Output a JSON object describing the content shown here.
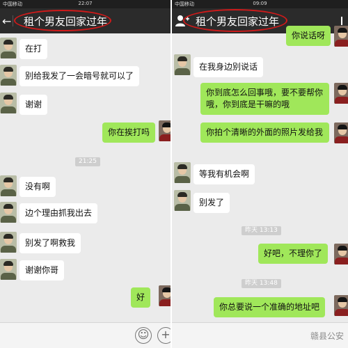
{
  "left": {
    "status": {
      "carrier": "中国移动",
      "time": "22:07"
    },
    "title": "租个男友回家过年",
    "messages": [
      {
        "id": "l1",
        "text": "在打"
      },
      {
        "id": "l2",
        "text": "别给我发了一会暗号就可以了"
      },
      {
        "id": "l3",
        "text": "谢谢"
      },
      {
        "id": "l4",
        "text": "你在挨打吗"
      },
      {
        "id": "l5",
        "text": "没有啊"
      },
      {
        "id": "l6",
        "text": "边个理由抓我出去"
      },
      {
        "id": "l7",
        "text": "别发了啊救我"
      },
      {
        "id": "l8",
        "text": "谢谢你哥"
      },
      {
        "id": "l9",
        "text": "好"
      }
    ],
    "timestamp": "21:25"
  },
  "right": {
    "status": {
      "carrier": "中国移动",
      "time": "09:09"
    },
    "title": "租个男友回家过年",
    "messages": [
      {
        "id": "r0",
        "text": "你说话呀"
      },
      {
        "id": "r1",
        "text": "在我身边别说话"
      },
      {
        "id": "r2",
        "text": "你到底怎么回事哦，要不要帮你哦，你到底是干嘛的哦"
      },
      {
        "id": "r3",
        "text": "你拍个清晰的外面的照片发给我"
      },
      {
        "id": "r4",
        "text": "等我有机会啊"
      },
      {
        "id": "r5",
        "text": "别发了"
      },
      {
        "id": "r6",
        "text": "好吧，不理你了"
      },
      {
        "id": "r7",
        "text": "你总要说一个准确的地址吧"
      }
    ],
    "timestamps": [
      "昨天 13:13",
      "昨天 13:48"
    ],
    "watermark": "赣县公安"
  },
  "colors": {
    "chat_bg": "#ebebeb",
    "incoming_bubble": "#ffffff",
    "outgoing_bubble": "#a0e75a",
    "header_bg": "#2b2b2b",
    "annotation_circle": "#d01a1a"
  }
}
